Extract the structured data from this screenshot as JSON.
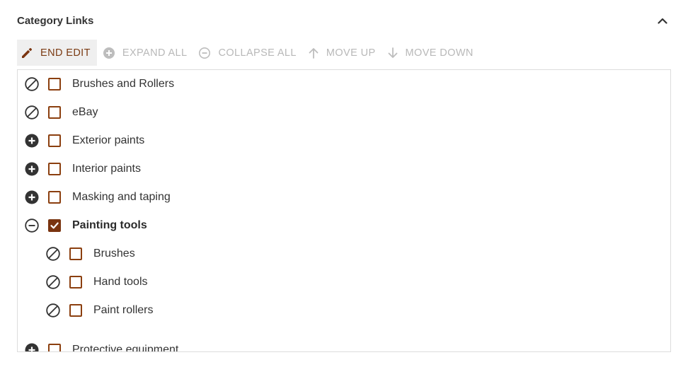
{
  "panel": {
    "title": "Category Links"
  },
  "toolbar": {
    "end_edit": "END EDIT",
    "expand_all": "EXPAND ALL",
    "collapse_all": "COLLAPSE ALL",
    "move_up": "MOVE UP",
    "move_down": "MOVE DOWN"
  },
  "tree": {
    "items": [
      {
        "label": "Brushes and Rollers",
        "state": "none",
        "checked": false
      },
      {
        "label": "eBay",
        "state": "none",
        "checked": false
      },
      {
        "label": "Exterior paints",
        "state": "expandable",
        "checked": false
      },
      {
        "label": "Interior paints",
        "state": "expandable",
        "checked": false
      },
      {
        "label": "Masking and taping",
        "state": "expandable",
        "checked": false
      },
      {
        "label": "Painting tools",
        "state": "expanded",
        "checked": true
      },
      {
        "label": "Brushes",
        "state": "none",
        "checked": false
      },
      {
        "label": "Hand tools",
        "state": "none",
        "checked": false
      },
      {
        "label": "Paint rollers",
        "state": "none",
        "checked": false
      },
      {
        "label": "Protective equipment",
        "state": "expandable",
        "checked": false
      }
    ]
  },
  "colors": {
    "accent": "#7a3410",
    "checkbox_border": "#8b3f0f",
    "disabled_text": "#b8b8b8"
  },
  "icons": {
    "end_edit": "pencil-icon",
    "expand_all": "plus-circle-icon",
    "collapse_all": "minus-circle-icon",
    "move_up": "arrow-up-icon",
    "move_down": "arrow-down-icon",
    "panel_toggle": "chevron-up-icon"
  }
}
